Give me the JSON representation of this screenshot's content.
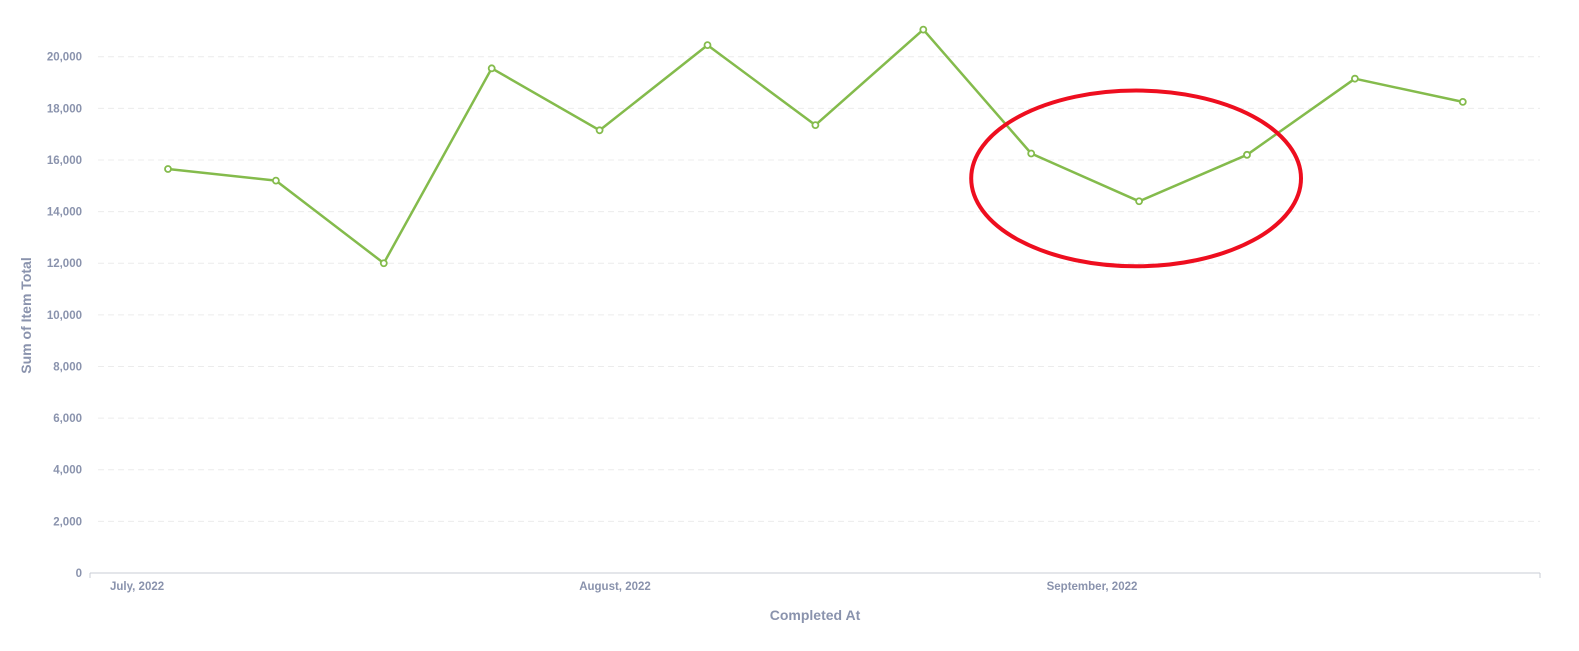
{
  "chart_data": {
    "type": "line",
    "xlabel": "Completed At",
    "ylabel": "Sum of Item Total",
    "x_tick_labels": [
      "July, 2022",
      "August, 2022",
      "September, 2022"
    ],
    "y_ticks": [
      0,
      2000,
      4000,
      6000,
      8000,
      10000,
      12000,
      14000,
      16000,
      18000,
      20000
    ],
    "y_tick_labels": [
      "0",
      "2,000",
      "4,000",
      "6,000",
      "8,000",
      "10,000",
      "12,000",
      "14,000",
      "16,000",
      "18,000",
      "20,000"
    ],
    "ylim": [
      0,
      21500
    ],
    "grid": true,
    "series": [
      {
        "values": [
          15650,
          15200,
          12000,
          19550,
          17150,
          20450,
          17350,
          21050,
          16250,
          14400,
          16200,
          19150,
          18250
        ]
      }
    ],
    "annotation": {
      "shape": "ellipse",
      "highlighted_points": [
        8,
        9,
        10
      ]
    }
  },
  "colors": {
    "series": "#84bb4c",
    "annotation": "#ee0e1f",
    "axis_text": "#8a93ad",
    "grid": "#ececec",
    "axis_line": "#c9ccd6"
  }
}
